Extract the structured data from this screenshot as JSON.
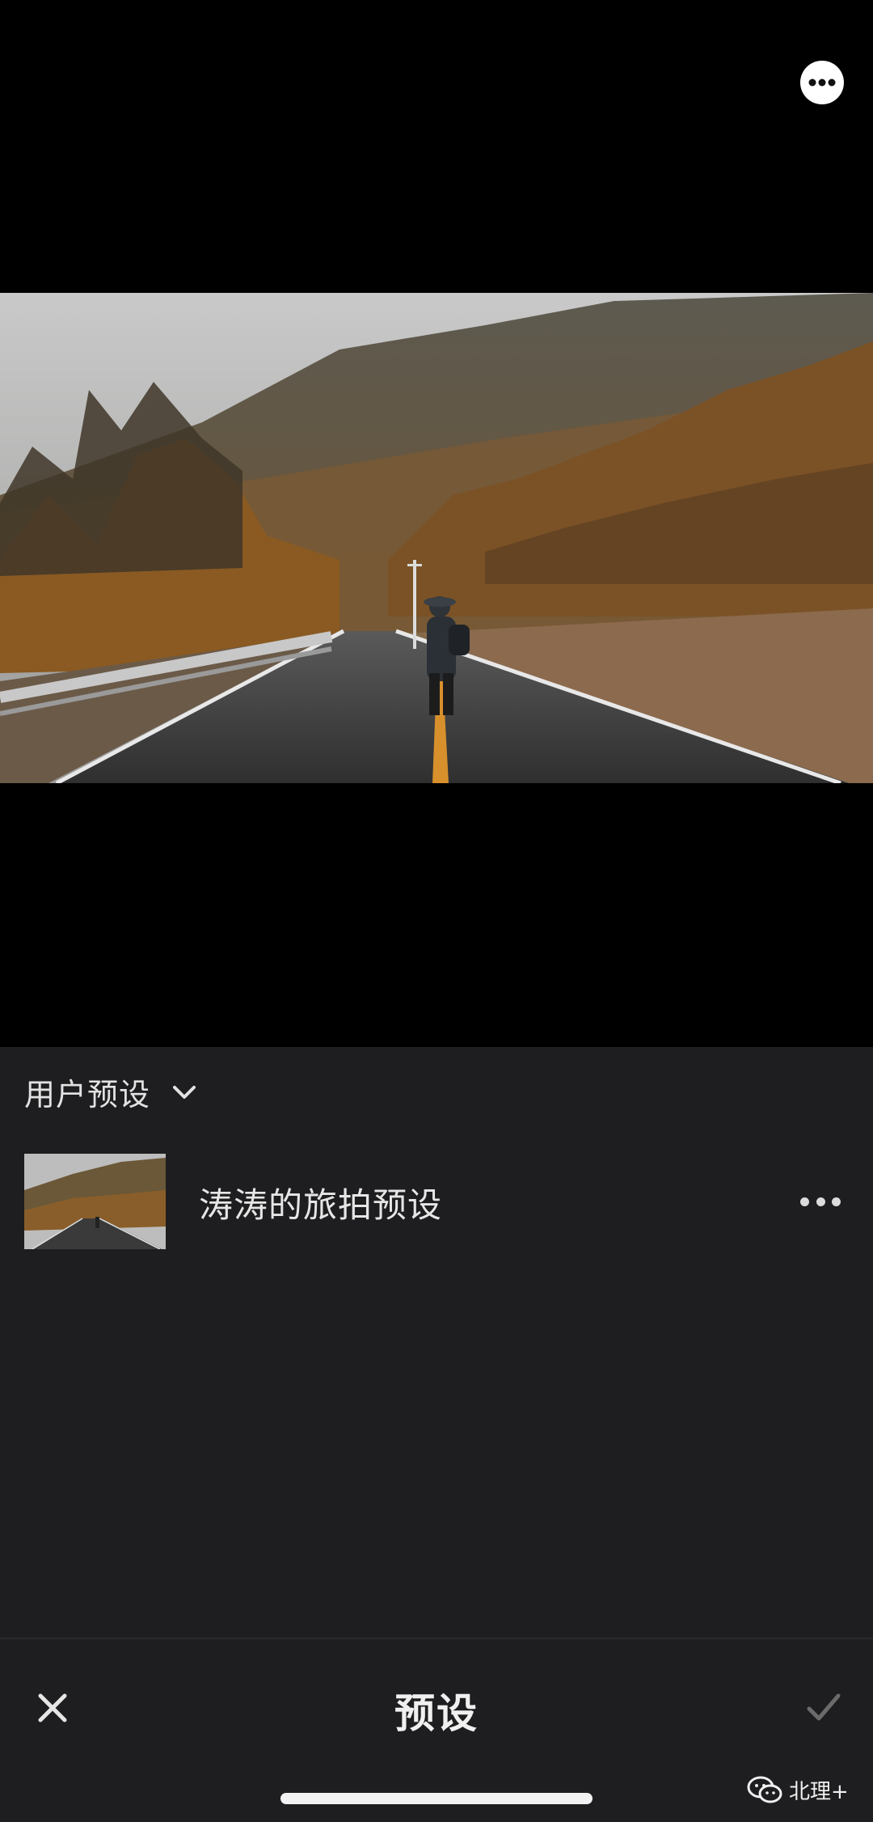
{
  "top": {
    "more_icon": "more-horizontal-icon"
  },
  "photo": {
    "description_icon": "preview-image"
  },
  "section": {
    "title": "用户预设",
    "chevron_icon": "chevron-down-icon"
  },
  "presets": [
    {
      "name": "涛涛的旅拍预设",
      "more_icon": "more-horizontal-icon"
    }
  ],
  "bottom": {
    "title": "预设",
    "close_icon": "close-icon",
    "confirm_icon": "check-icon",
    "watermark": "北理+",
    "watermark_icon": "wechat-icon"
  },
  "colors": {
    "background": "#000000",
    "panel": "#1e1e20",
    "text": "#e2e2e2"
  }
}
